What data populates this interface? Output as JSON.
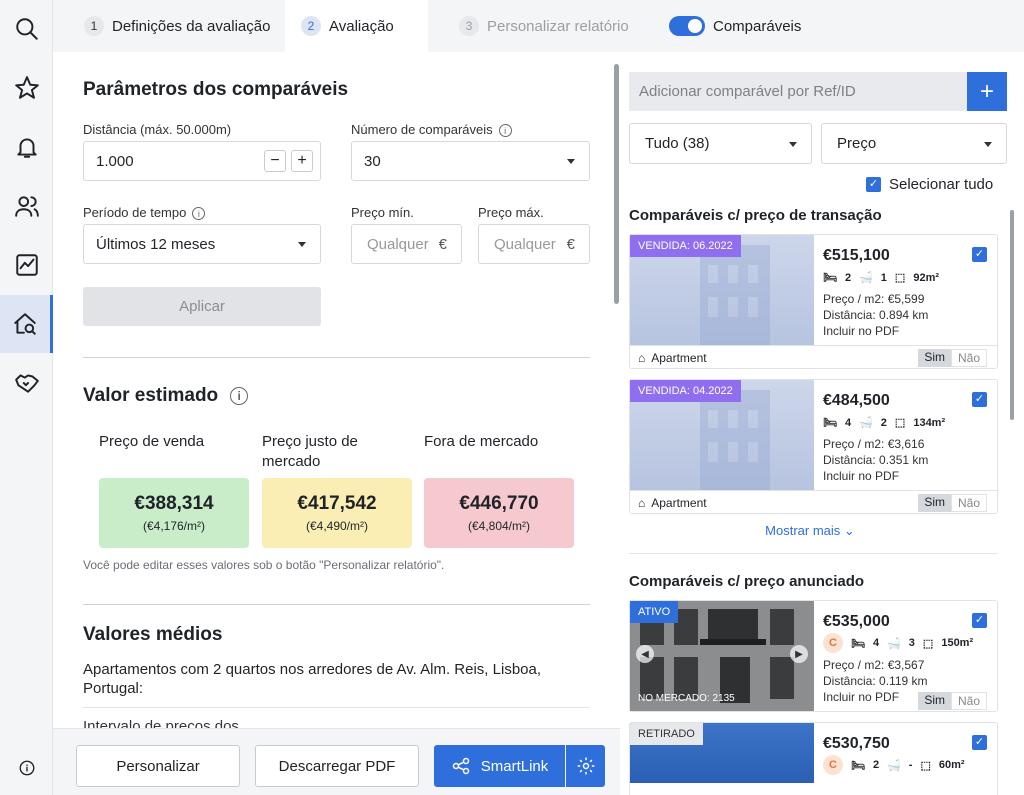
{
  "tabs": [
    {
      "num": "1",
      "label": "Definições da avaliação"
    },
    {
      "num": "2",
      "label": "Avaliação"
    },
    {
      "num": "3",
      "label": "Personalizar relatório"
    }
  ],
  "toggle_label": "Comparáveis",
  "params": {
    "title": "Parâmetros dos comparáveis",
    "distance_label": "Distância (máx. 50.000m)",
    "distance_value": "1.000",
    "count_label": "Número de comparáveis",
    "count_value": "30",
    "period_label": "Período de tempo",
    "period_value": "Últimos 12 meses",
    "price_min_label": "Preço mín.",
    "price_max_label": "Preço máx.",
    "price_placeholder": "Qualquer",
    "currency": "€",
    "apply_label": "Aplicar"
  },
  "estimate": {
    "title": "Valor estimado",
    "sale_label": "Preço de venda",
    "fair_label": "Preço justo de mercado",
    "out_label": "Fora de mercado",
    "sale_value": "€388,314",
    "sale_m2": "(€4,176/m²)",
    "fair_value": "€417,542",
    "fair_m2": "(€4,490/m²)",
    "out_value": "€446,770",
    "out_m2": "(€4,804/m²)",
    "note": "Você pode editar esses valores sob o botão \"Personalizar relatório\"."
  },
  "averages": {
    "title": "Valores médios",
    "text": "Apartamentos com 2 quartos nos arredores de Av. Alm. Reis, Lisboa, Portugal:",
    "cut_text": "Intervalo de preços dos"
  },
  "bottom": {
    "customize": "Personalizar",
    "download": "Descarregar PDF",
    "smartlink": "SmartLink"
  },
  "right": {
    "add_placeholder": "Adicionar comparável por Ref/ID",
    "filter_value": "Tudo (38)",
    "sort_value": "Preço",
    "select_all": "Selecionar tudo",
    "section_transaction": "Comparáveis c/ preço de transação",
    "section_listed": "Comparáveis c/ preço anunciado",
    "show_more": "Mostrar mais",
    "include_label": "Incluir no PDF",
    "yes": "Sim",
    "no": "Não",
    "type_label": "Apartment",
    "cards": [
      {
        "badge": "VENDIDA: 06.2022",
        "price": "€515,100",
        "beds": "2",
        "baths": "1",
        "area": "92m²",
        "ppm": "Preço / m2: €5,599",
        "dist": "Distância: 0.894 km"
      },
      {
        "badge": "VENDIDA: 04.2022",
        "price": "€484,500",
        "beds": "4",
        "baths": "2",
        "area": "134m²",
        "ppm": "Preço / m2: €3,616",
        "dist": "Distância: 0.351 km"
      },
      {
        "badge": "ATIVO",
        "market": "NO MERCADO: 2135",
        "energy": "C",
        "price": "€535,000",
        "beds": "4",
        "baths": "3",
        "area": "150m²",
        "ppm": "Preço / m2: €3,567",
        "dist": "Distância: 0.119 km"
      },
      {
        "badge": "RETIRADO",
        "energy": "C",
        "price": "€530,750",
        "beds": "2",
        "baths": "-",
        "area": "60m²"
      }
    ]
  }
}
